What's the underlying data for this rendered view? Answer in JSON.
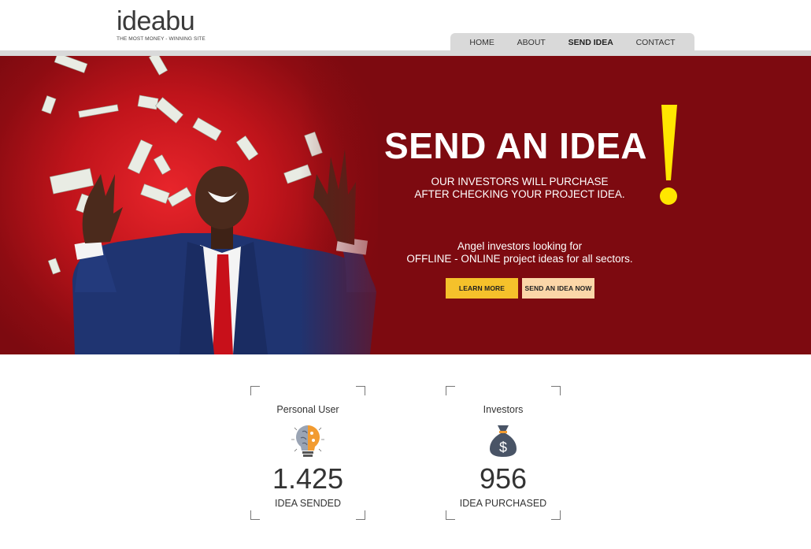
{
  "brand": {
    "name": "ideabu",
    "tagline": "THE MOST MONEY - WINNING SITE"
  },
  "nav": {
    "items": [
      {
        "label": "HOME",
        "active": false
      },
      {
        "label": "ABOUT",
        "active": false
      },
      {
        "label": "SEND IDEA",
        "active": true
      },
      {
        "label": "CONTACT",
        "active": false
      }
    ]
  },
  "hero": {
    "title": "SEND AN IDEA",
    "exclamation": "!",
    "subtitle_line1": "OUR INVESTORS WILL PURCHASE",
    "subtitle_line2": "AFTER CHECKING YOUR PROJECT IDEA.",
    "desc_line1": "Angel investors looking for",
    "desc_line2": "OFFLINE - ONLINE project ideas for all sectors.",
    "learn_more_label": "LEARN MORE",
    "send_now_label": "SEND AN IDEA NOW",
    "background_color": "#7d0a10",
    "accent_color": "#f5c12b"
  },
  "stats": [
    {
      "label": "Personal User",
      "icon": "lightbulb-brain-icon",
      "value": "1.425",
      "caption": "IDEA SENDED"
    },
    {
      "label": "Investors",
      "icon": "money-bag-icon",
      "value": "956",
      "caption": "IDEA PURCHASED"
    }
  ]
}
